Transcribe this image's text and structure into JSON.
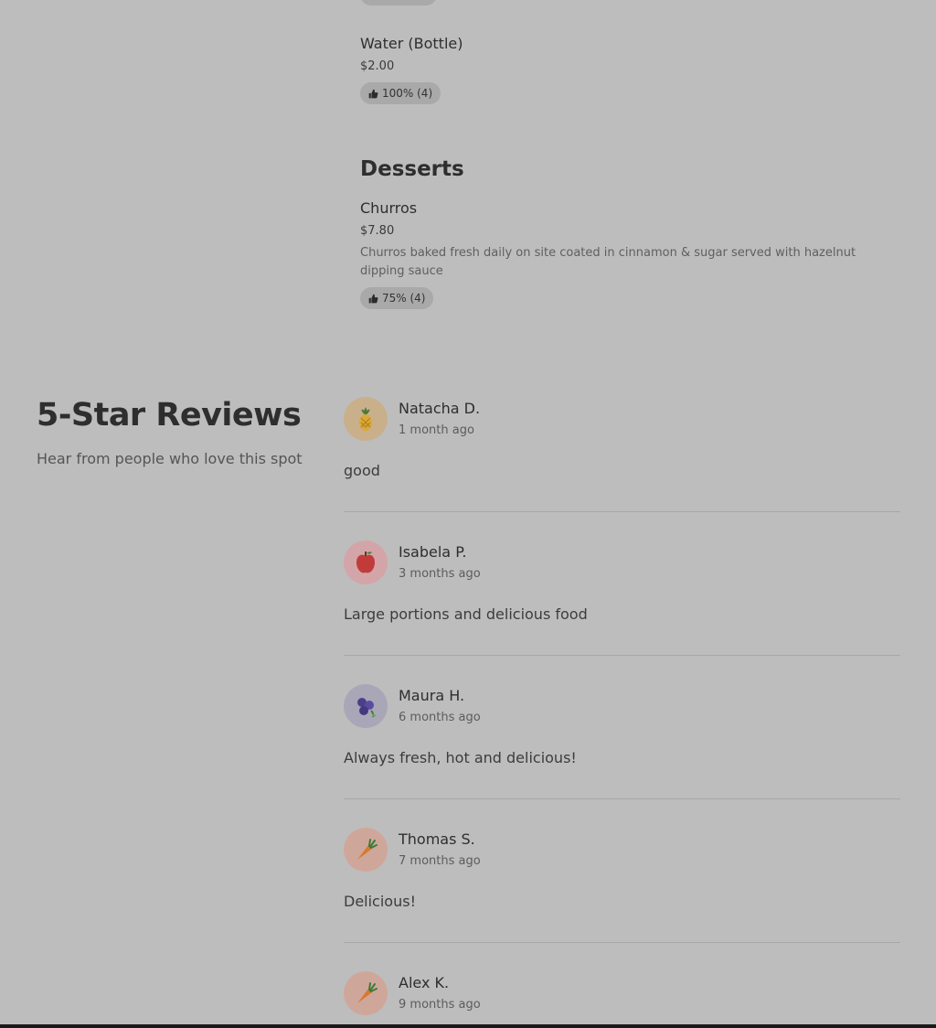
{
  "menu": {
    "items": [
      {
        "name": "Water (Bottle)",
        "price": "$2.00",
        "rating": "100% (4)"
      },
      {
        "name": "Churros",
        "price": "$7.80",
        "description": "Churros baked fresh daily on site coated in cinnamon & sugar served with hazelnut dipping sauce",
        "rating": "75% (4)"
      }
    ],
    "desserts_title": "Desserts"
  },
  "reviews": {
    "title": "5-Star Reviews",
    "subtitle": "Hear from people who love this spot",
    "list": [
      {
        "name": "Natacha D.",
        "time": "1 month ago",
        "text": "good",
        "avatar_icon": "pineapple-icon"
      },
      {
        "name": "Isabela P.",
        "time": "3 months ago",
        "text": "Large portions and delicious food",
        "avatar_icon": "apple-icon"
      },
      {
        "name": "Maura H.",
        "time": "6 months ago",
        "text": "Always fresh, hot and delicious!",
        "avatar_icon": "blueberries-icon"
      },
      {
        "name": "Thomas S.",
        "time": "7 months ago",
        "text": "Delicious!",
        "avatar_icon": "carrot-icon"
      },
      {
        "name": "Alex K.",
        "time": "9 months ago",
        "text": "",
        "avatar_icon": "carrot-icon"
      }
    ]
  },
  "colors": {
    "overlay_bg": "#bdbdbd",
    "pill_bg": "#a9a9a9"
  }
}
